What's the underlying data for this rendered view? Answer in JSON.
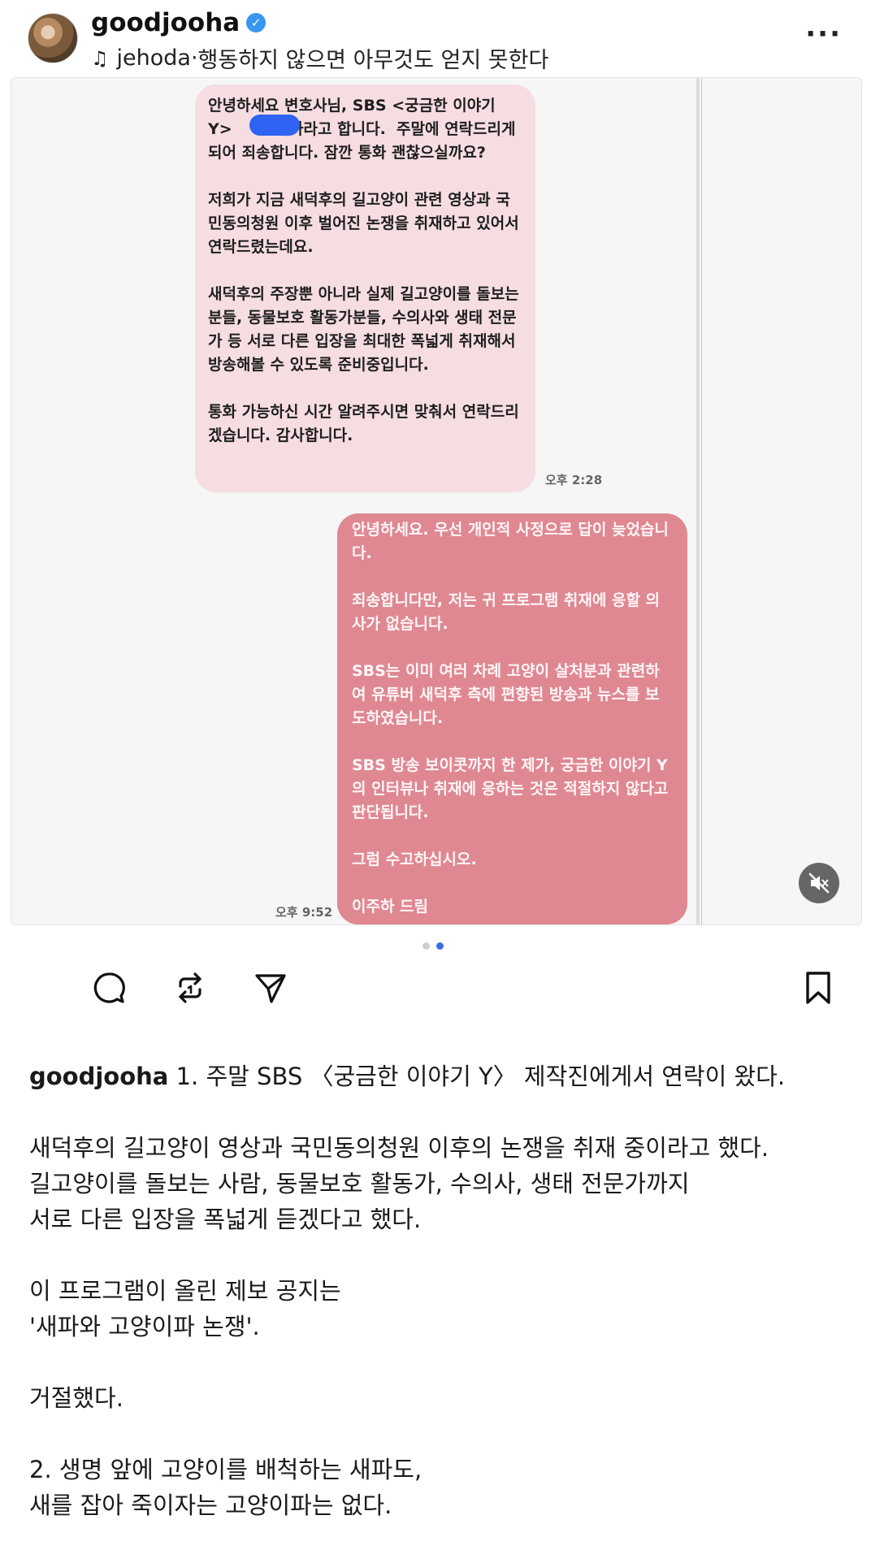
{
  "header": {
    "username": "goodjooha",
    "music_artist": "jehoda",
    "music_separator": " · ",
    "music_title": "행동하지 않으면 아무것도 얻지 못한다"
  },
  "media": {
    "incoming_message": "안녕하세요 변호사님, SBS <궁금한 이야기 Y>        작가라고 합니다.  주말에 연락드리게 되어 죄송합니다. 잠깐 통화 괜찮으실까요?\n\n저희가 지금 새덕후의 길고양이 관련 영상과 국민동의청원 이후 벌어진 논쟁을 취재하고 있어서 연락드렸는데요.\n\n새덕후의 주장뿐 아니라 실제 길고양이를 돌보는 분들, 동물보호 활동가분들, 수의사와 생태 전문가 등 서로 다른 입장을 최대한 폭넓게 취재해서 방송해볼 수 있도록 준비중입니다.\n\n통화 가능하신 시간 알려주시면 맞춰서 연락드리겠습니다. 감사합니다.",
    "incoming_time": "오후 2:28",
    "outgoing_message": "안녕하세요. 우선 개인적 사정으로 답이 늦었습니다.\n\n죄송합니다만, 저는 귀 프로그램 취재에 응할 의사가 없습니다.\n\nSBS는 이미 여러 차례 고양이 살처분과 관련하여 유튜버 새덕후 측에 편향된 방송과 뉴스를 보도하였습니다.\n\nSBS 방송 보이콧까지 한 제가, 궁금한 이야기 Y의 인터뷰나 취재에 응하는 것은 적절하지 않다고 판단됩니다.\n\n그럼 수고하십시오.\n\n이주하 드림",
    "outgoing_time": "오후 9:52"
  },
  "carousel": {
    "count": 2,
    "active_index": 1
  },
  "actions": {
    "icons": [
      "comment-icon",
      "repost-icon",
      "share-icon",
      "bookmark-icon"
    ]
  },
  "caption": {
    "username": "goodjooha",
    "text": " 1. 주말 SBS 〈궁금한 이야기 Y〉 제작진에게서 연락이 왔다.\n\n새덕후의 길고양이 영상과 국민동의청원 이후의 논쟁을 취재 중이라고 했다.\n길고양이를 돌보는 사람, 동물보호 활동가, 수의사, 생태 전문가까지\n서로 다른 입장을 폭넓게 듣겠다고 했다.\n\n이 프로그램이 올린 제보 공지는\n'새파와 고양이파 논쟁'.\n\n거절했다.\n\n2. 생명 앞에 고양이를 배척하는 새파도,\n새를 잡아 죽이자는 고양이파는 없다."
  },
  "colors": {
    "verified": "#3897f0",
    "incoming_bubble": "#f6dde1",
    "outgoing_bubble": "#df8892",
    "active_dot": "#3b6fe0"
  }
}
